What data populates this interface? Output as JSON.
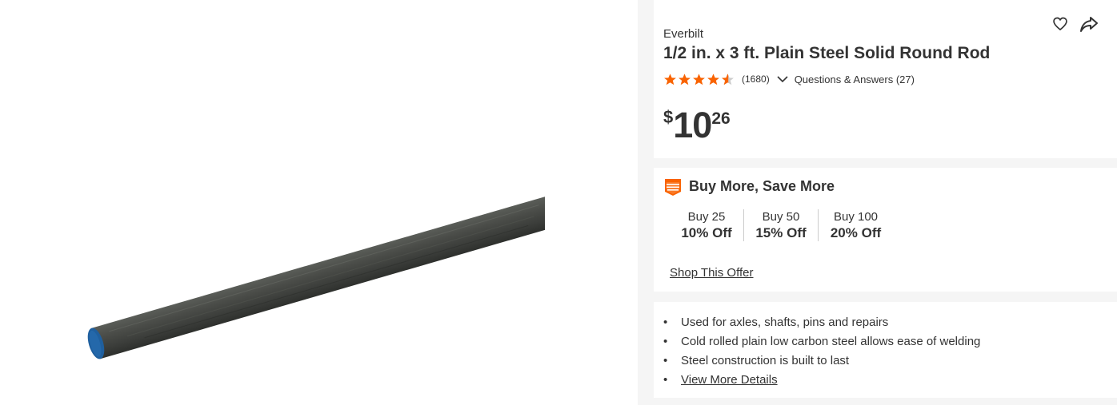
{
  "product": {
    "brand": "Everbilt",
    "title": "1/2 in. x 3 ft. Plain Steel Solid Round Rod",
    "rating_value": 4.5,
    "rating_count": "(1680)",
    "qa_label": "Questions & Answers (27)",
    "image_alt": "Steel round rod product image"
  },
  "price": {
    "currency": "$",
    "dollars": "10",
    "cents": "26"
  },
  "header_icons": {
    "favorite": "heart-icon",
    "share": "share-icon"
  },
  "bmsm": {
    "badge_icon": "save-more-badge-icon",
    "title": "Buy More, Save More",
    "tiers": [
      {
        "qty": "Buy 25",
        "off": "10% Off"
      },
      {
        "qty": "Buy 50",
        "off": "15% Off"
      },
      {
        "qty": "Buy 100",
        "off": "20% Off"
      }
    ],
    "shop_label": "Shop This Offer"
  },
  "highlights": {
    "items": [
      "Used for axles, shafts, pins and repairs",
      "Cold rolled plain low carbon steel allows ease of welding",
      "Steel construction is built to last"
    ],
    "more_label": "View More Details"
  },
  "colors": {
    "star": "#f96302",
    "text": "#333333",
    "panel_bg": "#f5f5f5",
    "rod_end": "#1f5f9e"
  }
}
